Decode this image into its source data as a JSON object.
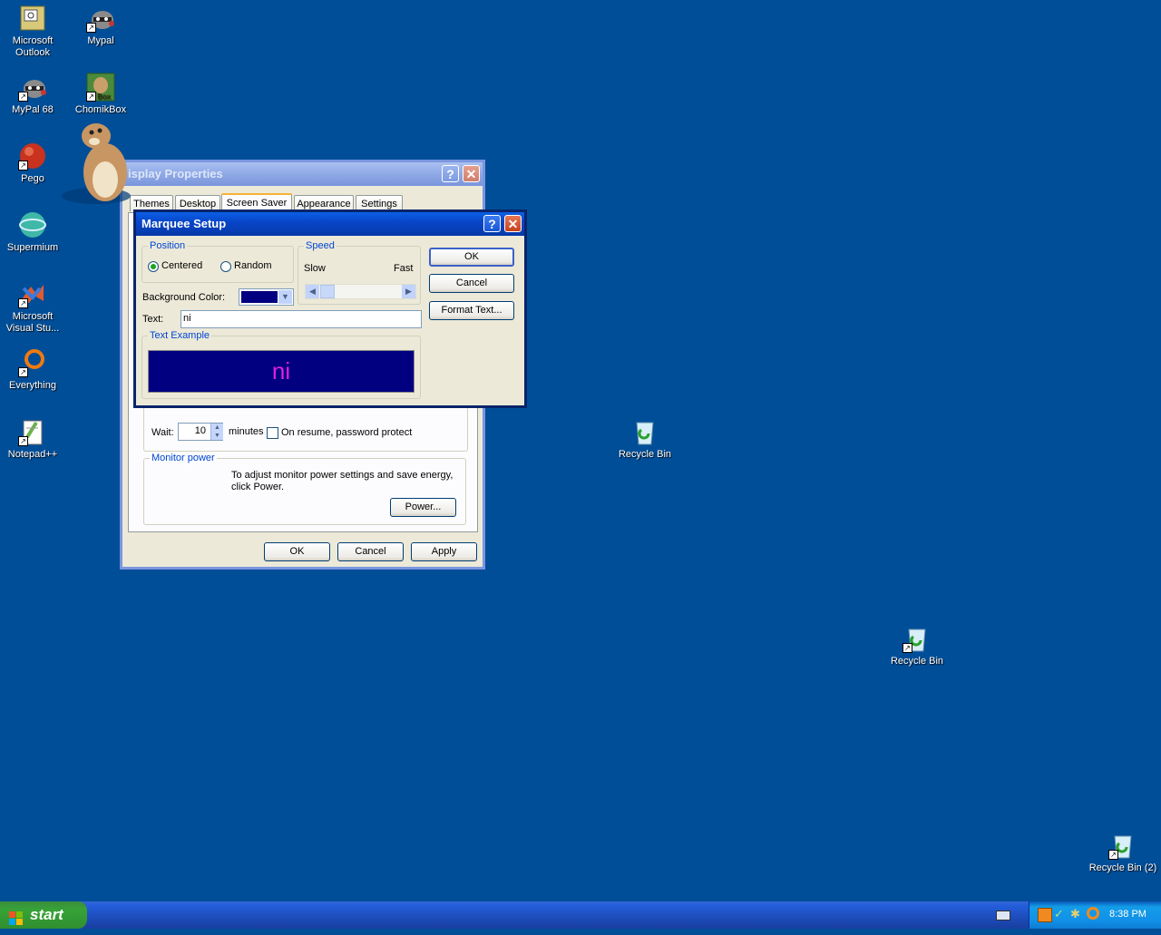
{
  "desktop": {
    "icons": [
      {
        "label": "Microsoft Outlook"
      },
      {
        "label": "Mypal"
      },
      {
        "label": "MyPal 68"
      },
      {
        "label": "ChomikBox"
      },
      {
        "label": "Pego"
      },
      {
        "label": "Supermium"
      },
      {
        "label": "Microsoft Visual Stu..."
      },
      {
        "label": "Everything"
      },
      {
        "label": "Notepad++"
      },
      {
        "label": "Recycle Bin"
      },
      {
        "label": "Recycle Bin"
      },
      {
        "label": "Recycle Bin (2)"
      }
    ]
  },
  "display_properties": {
    "title": "isplay Properties",
    "tabs": [
      "Themes",
      "Desktop",
      "Screen Saver",
      "Appearance",
      "Settings"
    ],
    "selected_tab": "Screen Saver",
    "wait_label": "Wait:",
    "wait_value": "10",
    "minutes_label": "minutes",
    "password_protect_label": "On resume, password protect",
    "password_protect_checked": false,
    "monitor_power_group": "Monitor power",
    "monitor_power_text": "To adjust monitor power settings and save energy, click Power.",
    "power_button": "Power...",
    "ok_button": "OK",
    "cancel_button": "Cancel",
    "apply_button": "Apply"
  },
  "marquee_setup": {
    "title": "Marquee Setup",
    "position_group": "Position",
    "centered_label": "Centered",
    "random_label": "Random",
    "position_selected": "Centered",
    "speed_group": "Speed",
    "slow_label": "Slow",
    "fast_label": "Fast",
    "background_color_label": "Background Color:",
    "background_color": "#000080",
    "text_label": "Text:",
    "text_value": "ni",
    "text_example_group": "Text Example",
    "preview_text": "ni",
    "preview_color": "#e020e0",
    "ok_button": "OK",
    "cancel_button": "Cancel",
    "format_text_button": "Format Text..."
  },
  "taskbar": {
    "start_label": "start",
    "clock": "8:38 PM"
  }
}
